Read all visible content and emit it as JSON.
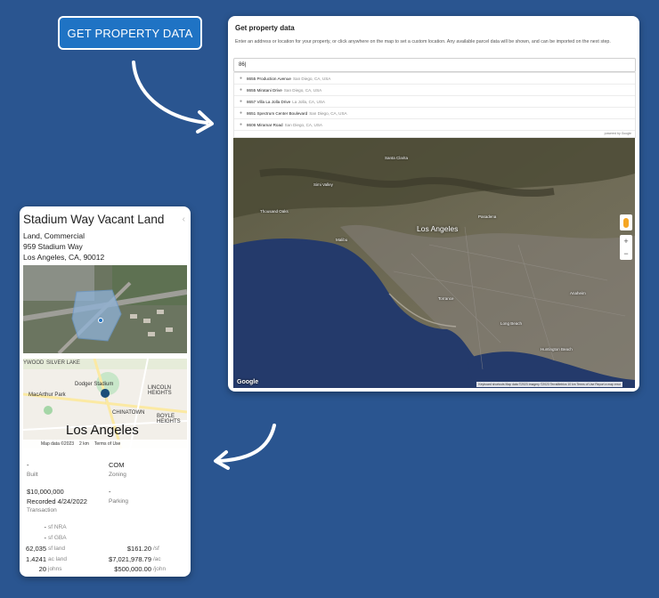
{
  "cta": {
    "label": "GET PROPERTY DATA"
  },
  "panel": {
    "title": "Get property data",
    "description": "Enter an address or location for your property, or click anywhere on the map to set a custom location. Any available parcel data will be shown, and can be imported on the next step.",
    "input_value": "86|",
    "suggestions": [
      {
        "main": "8655 Production Avenue",
        "sub": "San Diego, CA, USA"
      },
      {
        "main": "8655 Miratani Drive",
        "sub": "San Diego, CA, USA"
      },
      {
        "main": "8657 Villa La Jolla Drive",
        "sub": "La Jolla, CA, USA"
      },
      {
        "main": "8651 Spectrum Center Boulevard",
        "sub": "San Diego, CA, USA"
      },
      {
        "main": "8606 Miramar Road",
        "sub": "San Diego, CA, USA"
      }
    ],
    "powered_by": "powered by Google",
    "map": {
      "city_label": "Los Angeles",
      "google": "Google",
      "attribution": "Keyboard shortcuts   Map data ©2023 Imagery ©2023 TerraMetrics   10 km   Terms of Use   Report a map error",
      "places": [
        "Santa Clarita",
        "Simi Valley",
        "Thousand Oaks",
        "Malibu",
        "Pasadena",
        "Long Beach",
        "Huntington Beach",
        "Torrance",
        "Anaheim"
      ]
    }
  },
  "card": {
    "title": "Stadium Way Vacant Land",
    "type": "Land, Commercial",
    "street": "959 Stadium Way",
    "city_line": "Los Angeles, CA, 90012",
    "minimap": {
      "city": "Los Angeles",
      "places": [
        "SILVER LAKE",
        "Dodger Stadium",
        "MacArthur Park",
        "LINCOLN HEIGHTS",
        "CHINATOWN",
        "BOYLE HEIGHTS",
        "YWOOD"
      ],
      "data_label": "Map data ©2023",
      "scale": "2 km",
      "terms": "Terms of Use"
    },
    "stats": {
      "built_value": "-",
      "built_label": "Built",
      "zoning_value": "COM",
      "zoning_label": "Zoning",
      "price": "$10,000,000",
      "recorded": "Recorded 4/24/2022",
      "transaction_label": "Transaction",
      "parking_value": "-",
      "parking_label": "Parking"
    },
    "metrics_left": [
      {
        "num": "-",
        "unit": "sf NRA"
      },
      {
        "num": "-",
        "unit": "sf GBA"
      },
      {
        "num": "62,035",
        "unit": "sf land"
      },
      {
        "num": "1.4241",
        "unit": "ac land"
      },
      {
        "num": "20",
        "unit": "johns"
      }
    ],
    "metrics_right": [
      {
        "num": "$161.20",
        "unit": "/sf"
      },
      {
        "num": "$7,021,978.79",
        "unit": "/ac"
      },
      {
        "num": "$500,000.00",
        "unit": "/john"
      }
    ]
  },
  "colors": {
    "background": "#2a5590",
    "button": "#1f73c4",
    "water": "#243a6b"
  }
}
